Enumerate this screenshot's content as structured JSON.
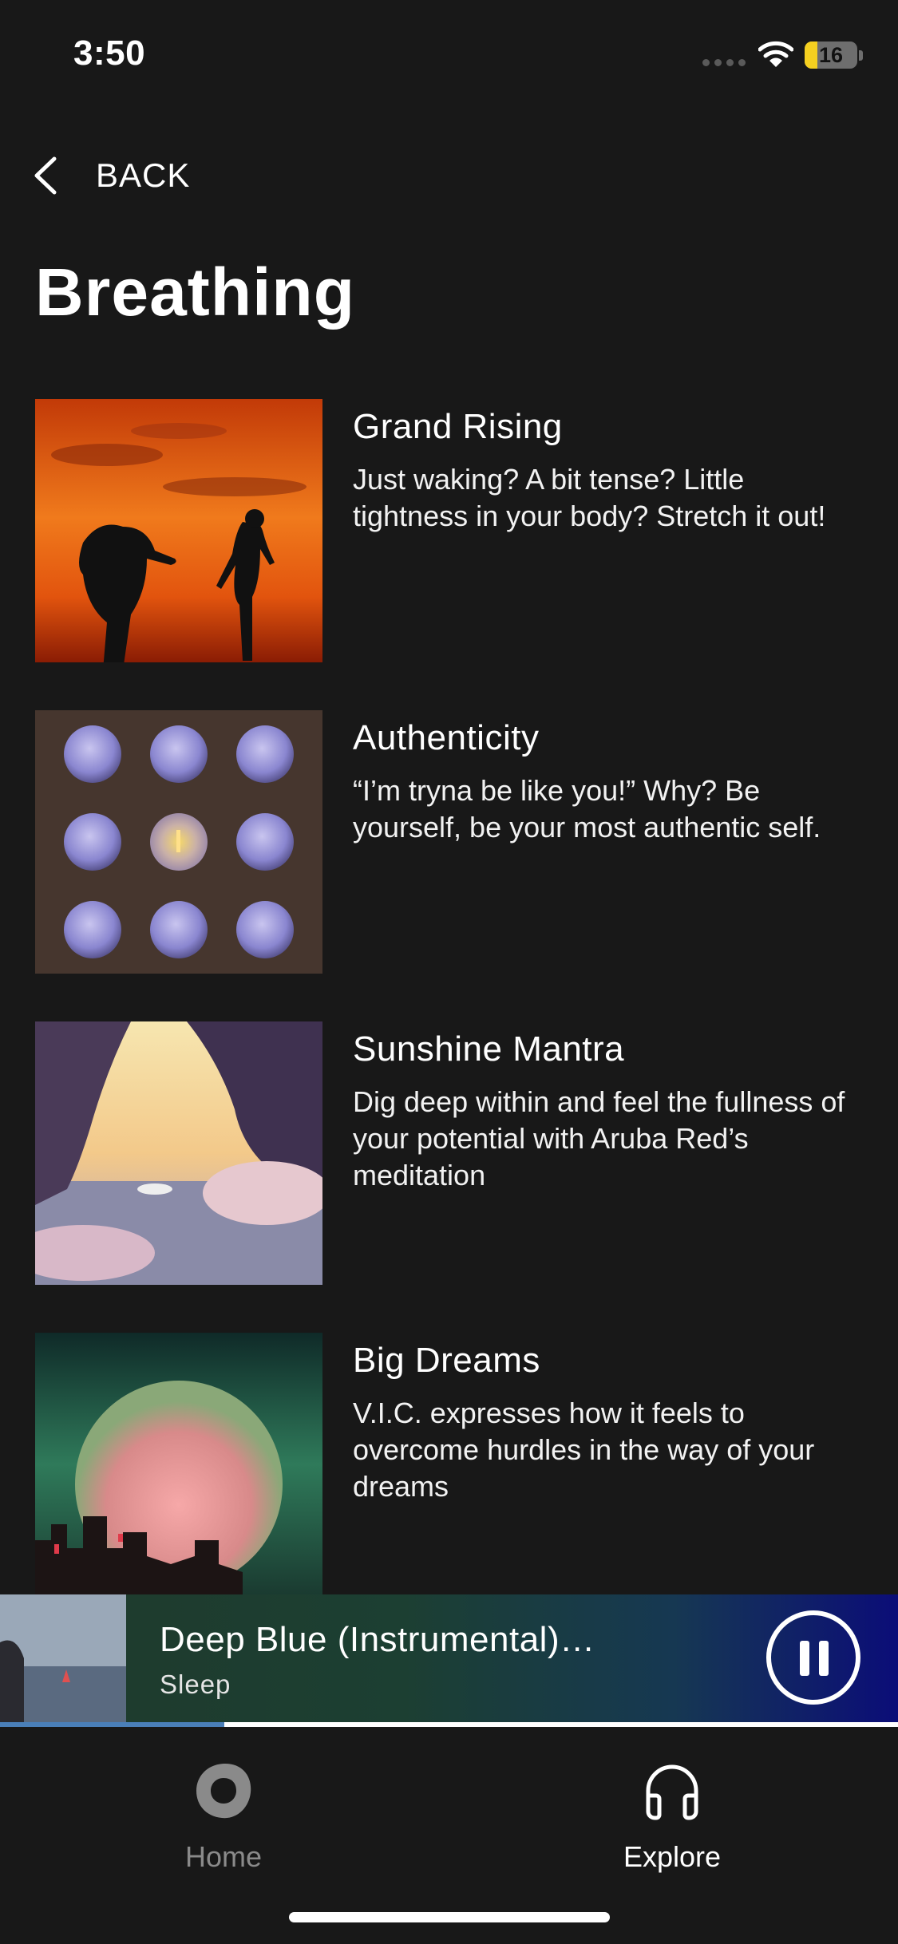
{
  "status_bar": {
    "time": "3:50",
    "battery_level": "16"
  },
  "nav": {
    "back_label": "BACK"
  },
  "page": {
    "title": "Breathing"
  },
  "items": [
    {
      "title": "Grand Rising",
      "description": "Just waking? A bit tense? Little tightness in your body? Stretch it out!",
      "locked": false
    },
    {
      "title": "Authenticity",
      "description": "“I’m tryna be like you!” Why? Be yourself,  be your most authentic self.",
      "locked": false
    },
    {
      "title": "Sunshine Mantra",
      "description": "Dig deep within and feel the fullness of your potential with Aruba Red’s meditation",
      "locked": false
    },
    {
      "title": "Big Dreams",
      "description": "V.I.C. expresses how it feels to overcome hurdles in the way of your dreams",
      "locked": true
    }
  ],
  "now_playing": {
    "title": "Deep Blue (Instrumental)…",
    "subtitle": "Sleep",
    "progress": 0.25
  },
  "tabs": [
    {
      "label": "Home",
      "icon": "home-blob-icon",
      "active": false
    },
    {
      "label": "Explore",
      "icon": "headphones-icon",
      "active": true
    }
  ],
  "colors": {
    "background": "#181818",
    "progress": "#4a7fb8",
    "inactive_tab": "#8a8a8a"
  }
}
